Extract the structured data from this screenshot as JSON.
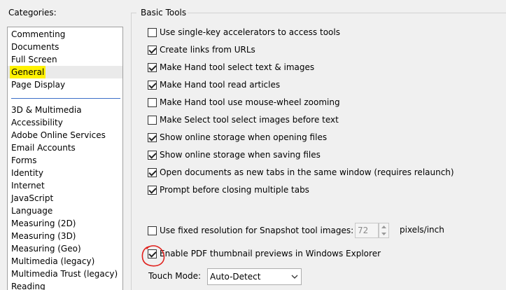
{
  "categories": {
    "label": "Categories:",
    "items": [
      {
        "label": "Commenting"
      },
      {
        "label": "Documents"
      },
      {
        "label": "Full Screen"
      },
      {
        "label": "General",
        "highlighted": true
      },
      {
        "label": "Page Display"
      },
      {
        "label": "3D & Multimedia"
      },
      {
        "label": "Accessibility"
      },
      {
        "label": "Adobe Online Services"
      },
      {
        "label": "Email Accounts"
      },
      {
        "label": "Forms"
      },
      {
        "label": "Identity"
      },
      {
        "label": "Internet"
      },
      {
        "label": "JavaScript"
      },
      {
        "label": "Language"
      },
      {
        "label": "Measuring (2D)"
      },
      {
        "label": "Measuring (3D)"
      },
      {
        "label": "Measuring (Geo)"
      },
      {
        "label": "Multimedia (legacy)"
      },
      {
        "label": "Multimedia Trust (legacy)"
      },
      {
        "label": "Reading"
      }
    ]
  },
  "basic_tools": {
    "title": "Basic Tools",
    "options": [
      {
        "label": "Use single-key accelerators to access tools",
        "checked": false
      },
      {
        "label": "Create links from URLs",
        "checked": true
      },
      {
        "label": "Make Hand tool select text & images",
        "checked": true
      },
      {
        "label": "Make Hand tool read articles",
        "checked": true
      },
      {
        "label": "Make Hand tool use mouse-wheel zooming",
        "checked": false
      },
      {
        "label": "Make Select tool select images before text",
        "checked": false
      },
      {
        "label": "Show online storage when opening files",
        "checked": true
      },
      {
        "label": "Show online storage when saving files",
        "checked": true
      },
      {
        "label": "Open documents as new tabs in the same window (requires relaunch)",
        "checked": true
      },
      {
        "label": "Prompt before closing multiple tabs",
        "checked": true
      }
    ],
    "snapshot": {
      "label": "Use fixed resolution for Snapshot tool images:",
      "checked": false,
      "value": "72",
      "unit": "pixels/inch"
    },
    "thumbnail": {
      "label": "Enable PDF thumbnail previews in Windows Explorer",
      "checked": true
    },
    "touch_mode": {
      "label": "Touch Mode:",
      "value": "Auto-Detect"
    }
  },
  "colors": {
    "highlight": "#fff200",
    "annotation_circle": "#e0201c",
    "separator": "#3c6fc7"
  }
}
